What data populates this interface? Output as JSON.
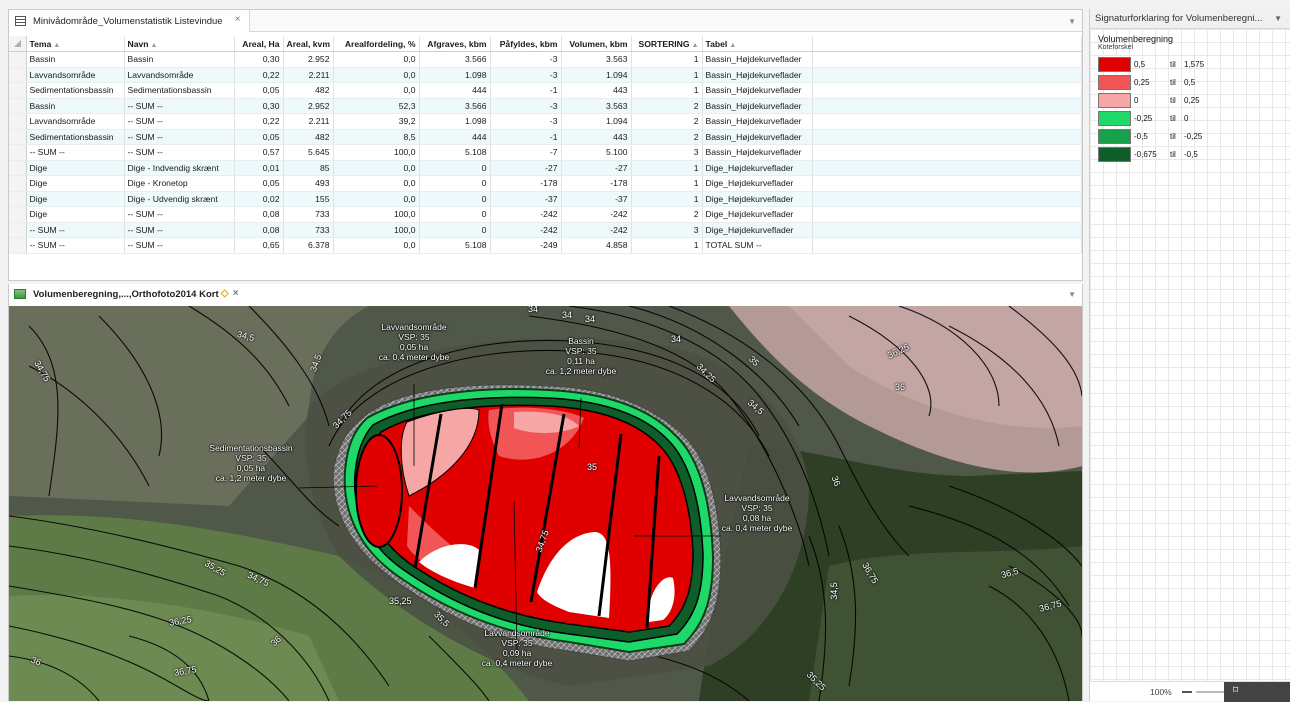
{
  "table_pane": {
    "tab_title": "Minivådområde_Volumenstatistik Listevindue",
    "tab_close": "×",
    "columns": [
      {
        "label": "Tema",
        "sort": "▲"
      },
      {
        "label": "Navn",
        "sort": "▲"
      },
      {
        "label": "Areal, Ha",
        "sort": ""
      },
      {
        "label": "Areal, kvm",
        "sort": ""
      },
      {
        "label": "Arealfordeling, %",
        "sort": ""
      },
      {
        "label": "Afgraves, kbm",
        "sort": ""
      },
      {
        "label": "Påfyldes, kbm",
        "sort": ""
      },
      {
        "label": "Volumen, kbm",
        "sort": ""
      },
      {
        "label": "SORTERING",
        "sort": "▲"
      },
      {
        "label": "Tabel",
        "sort": "▲"
      }
    ],
    "rows": [
      [
        "Bassin",
        "Bassin",
        "0,30",
        "2.952",
        "0,0",
        "3.566",
        "-3",
        "3.563",
        "1",
        "Bassin_Højdekurveflader"
      ],
      [
        "Lavvandsområde",
        "Lavvandsområde",
        "0,22",
        "2.211",
        "0,0",
        "1.098",
        "-3",
        "1.094",
        "1",
        "Bassin_Højdekurveflader"
      ],
      [
        "Sedimentationsbassin",
        "Sedimentationsbassin",
        "0,05",
        "482",
        "0,0",
        "444",
        "-1",
        "443",
        "1",
        "Bassin_Højdekurveflader"
      ],
      [
        "Bassin",
        "-- SUM --",
        "0,30",
        "2.952",
        "52,3",
        "3.566",
        "-3",
        "3.563",
        "2",
        "Bassin_Højdekurveflader"
      ],
      [
        "Lavvandsområde",
        "-- SUM --",
        "0,22",
        "2.211",
        "39,2",
        "1.098",
        "-3",
        "1.094",
        "2",
        "Bassin_Højdekurveflader"
      ],
      [
        "Sedimentationsbassin",
        "-- SUM --",
        "0,05",
        "482",
        "8,5",
        "444",
        "-1",
        "443",
        "2",
        "Bassin_Højdekurveflader"
      ],
      [
        "-- SUM --",
        "-- SUM --",
        "0,57",
        "5.645",
        "100,0",
        "5.108",
        "-7",
        "5.100",
        "3",
        "Bassin_Højdekurveflader"
      ],
      [
        "Dige",
        "Dige - Indvendig skrænt",
        "0,01",
        "85",
        "0,0",
        "0",
        "-27",
        "-27",
        "1",
        "Dige_Højdekurveflader"
      ],
      [
        "Dige",
        "Dige - Kronetop",
        "0,05",
        "493",
        "0,0",
        "0",
        "-178",
        "-178",
        "1",
        "Dige_Højdekurveflader"
      ],
      [
        "Dige",
        "Dige - Udvendig skrænt",
        "0,02",
        "155",
        "0,0",
        "0",
        "-37",
        "-37",
        "1",
        "Dige_Højdekurveflader"
      ],
      [
        "Dige",
        "-- SUM --",
        "0,08",
        "733",
        "100,0",
        "0",
        "-242",
        "-242",
        "2",
        "Dige_Højdekurveflader"
      ],
      [
        "-- SUM --",
        "-- SUM --",
        "0,08",
        "733",
        "100,0",
        "0",
        "-242",
        "-242",
        "3",
        "Dige_Højdekurveflader"
      ],
      [
        "-- SUM --",
        "-- SUM --",
        "0,65",
        "6.378",
        "0,0",
        "5.108",
        "-249",
        "4.858",
        "1",
        "TOTAL SUM --"
      ]
    ]
  },
  "map_pane": {
    "tab_title": "Volumenberegning,...,Orthofoto2014 Kort",
    "pin_glyph": "◇",
    "tab_close": "×",
    "area_labels": [
      {
        "lines": [
          "Lavvandsområde",
          "VSP: 35",
          "0,05 ha",
          "ca. 0,4 meter dybe"
        ]
      },
      {
        "lines": [
          "Bassin",
          "VSP: 35",
          "0,11 ha",
          "ca. 1,2 meter dybe"
        ]
      },
      {
        "lines": [
          "Sedimentationsbassin",
          "VSP: 35",
          "0,05 ha",
          "ca. 1,2 meter dybe"
        ]
      },
      {
        "lines": [
          "Lavvandsområde",
          "VSP: 35",
          "0,08 ha",
          "ca. 0,4 meter dybe"
        ]
      },
      {
        "lines": [
          "Lavvandsområde",
          "VSP: 35",
          "0,09 ha",
          "ca. 0,4 meter dybe"
        ]
      }
    ],
    "contour_labels": [
      "34,5",
      "34,75",
      "34,5",
      "34,75",
      "34",
      "34",
      "34",
      "34",
      "34,25",
      "34,5",
      "36,25",
      "36",
      "35",
      "35",
      "34,75",
      "36",
      "36,75",
      "36,5",
      "36,75",
      "34,5",
      "35,25",
      "34,75",
      "35,5",
      "35,25",
      "36,25",
      "36",
      "36",
      "36,75",
      "35,25"
    ]
  },
  "legend": {
    "header": "Signaturforklaring for Volumenberegni...",
    "dropdown_glyph": "▼",
    "title": "Volumenberegning",
    "subtitle": "Koteforskel",
    "items": [
      {
        "from": "0,5",
        "til": "til",
        "to": "1,575",
        "color": "#e00000"
      },
      {
        "from": "0,25",
        "til": "til",
        "to": "0,5",
        "color": "#f25555"
      },
      {
        "from": "0",
        "til": "til",
        "to": "0,25",
        "color": "#f7a6a6"
      },
      {
        "from": "-0,25",
        "til": "til",
        "to": "0",
        "color": "#1ed96a"
      },
      {
        "from": "-0,5",
        "til": "til",
        "to": "-0,25",
        "color": "#16a14a"
      },
      {
        "from": "-0,675",
        "til": "til",
        "to": "-0,5",
        "color": "#0d5e28"
      }
    ],
    "zoom": "100%",
    "fit_glyph": "⌑"
  }
}
